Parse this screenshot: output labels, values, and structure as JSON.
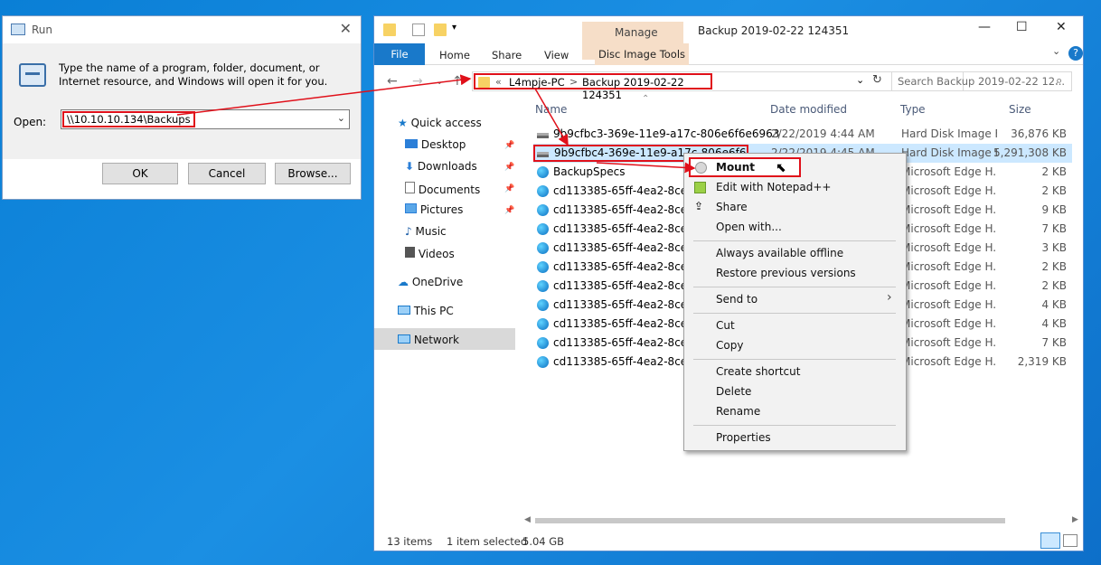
{
  "run_dialog": {
    "title": "Run",
    "description": "Type the name of a program, folder, document, or Internet resource, and Windows will open it for you.",
    "open_label": "Open:",
    "open_value": "\\\\10.10.10.134\\Backups",
    "ok": "OK",
    "cancel": "Cancel",
    "browse": "Browse..."
  },
  "explorer": {
    "title": "Backup 2019-02-22 124351",
    "manage_label": "Manage",
    "ribbon_tabs": {
      "file": "File",
      "home": "Home",
      "share": "Share",
      "view": "View",
      "disc_tools": "Disc Image Tools"
    },
    "address": {
      "chevron": "«",
      "pc": "L4mpje-PC",
      "sep": ">",
      "folder": "Backup 2019-02-22 124351"
    },
    "search_placeholder": "Search Backup 2019-02-22 12...",
    "nav": {
      "quick_access": "Quick access",
      "desktop": "Desktop",
      "downloads": "Downloads",
      "documents": "Documents",
      "pictures": "Pictures",
      "music": "Music",
      "videos": "Videos",
      "onedrive": "OneDrive",
      "thispc": "This PC",
      "network": "Network"
    },
    "columns": {
      "name": "Name",
      "date": "Date modified",
      "type": "Type",
      "size": "Size"
    },
    "files": [
      {
        "name": "9b9cfbc3-369e-11e9-a17c-806e6f6e6963",
        "date": "2/22/2019 4:44 AM",
        "type": "Hard Disk Image F...",
        "size": "36,876 KB"
      },
      {
        "name": "9b9cfbc4-369e-11e9-a17c-806e6f6e6963",
        "date": "2/22/2019 4:45 AM",
        "type": "Hard Disk Image F...",
        "size": "5,291,308 KB"
      },
      {
        "name": "BackupSpecs",
        "date": "",
        "type": "Microsoft Edge H...",
        "size": "2 KB"
      },
      {
        "name": "cd113385-65ff-4ea2-8ced-5",
        "date": "",
        "type": "Microsoft Edge H...",
        "size": "2 KB"
      },
      {
        "name": "cd113385-65ff-4ea2-8ced-5",
        "date": "",
        "type": "Microsoft Edge H...",
        "size": "9 KB"
      },
      {
        "name": "cd113385-65ff-4ea2-8ced-5",
        "date": "",
        "type": "Microsoft Edge H...",
        "size": "7 KB"
      },
      {
        "name": "cd113385-65ff-4ea2-8ced-5",
        "date": "",
        "type": "Microsoft Edge H...",
        "size": "3 KB"
      },
      {
        "name": "cd113385-65ff-4ea2-8ced-5",
        "date": "",
        "type": "Microsoft Edge H...",
        "size": "2 KB"
      },
      {
        "name": "cd113385-65ff-4ea2-8ced-5",
        "date": "",
        "type": "Microsoft Edge H...",
        "size": "2 KB"
      },
      {
        "name": "cd113385-65ff-4ea2-8ced-5",
        "date": "",
        "type": "Microsoft Edge H...",
        "size": "4 KB"
      },
      {
        "name": "cd113385-65ff-4ea2-8ced-5",
        "date": "",
        "type": "Microsoft Edge H...",
        "size": "4 KB"
      },
      {
        "name": "cd113385-65ff-4ea2-8ced-5",
        "date": "",
        "type": "Microsoft Edge H...",
        "size": "7 KB"
      },
      {
        "name": "cd113385-65ff-4ea2-8ced-5",
        "date": "",
        "type": "Microsoft Edge H...",
        "size": "2,319 KB"
      }
    ],
    "status": {
      "items": "13 items",
      "selected": "1 item selected",
      "size": "5.04 GB"
    }
  },
  "context_menu": {
    "mount": "Mount",
    "edit_npp": "Edit with Notepad++",
    "share": "Share",
    "open_with": "Open with...",
    "offline": "Always available offline",
    "restore": "Restore previous versions",
    "send_to": "Send to",
    "cut": "Cut",
    "copy": "Copy",
    "create_shortcut": "Create shortcut",
    "delete": "Delete",
    "rename": "Rename",
    "properties": "Properties"
  },
  "colors": {
    "accent": "#1979ca",
    "highlight": "#e0101a",
    "selection": "#cce8ff"
  }
}
